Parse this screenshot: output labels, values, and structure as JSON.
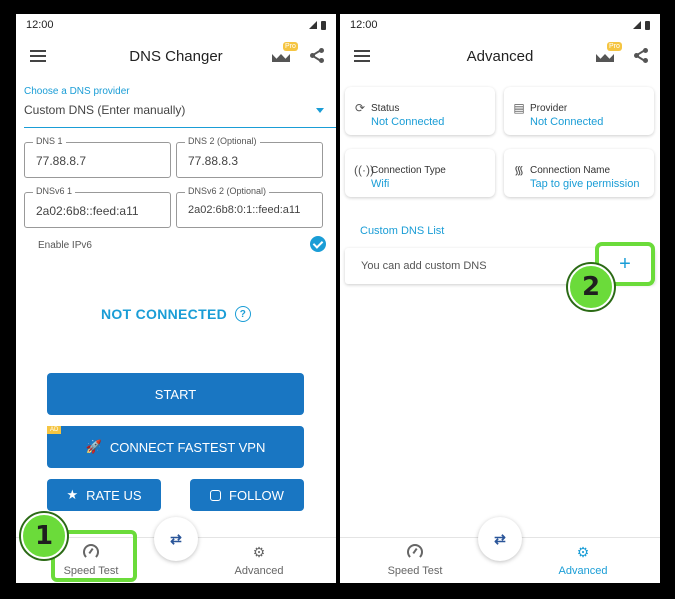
{
  "left": {
    "time": "12:00",
    "title": "DNS Changer",
    "pro_badge": "Pro",
    "provider_label": "Choose a DNS provider",
    "provider_value": "Custom DNS (Enter manually)",
    "fields": [
      {
        "label": "DNS 1",
        "value": "77.88.8.7"
      },
      {
        "label": "DNS 2 (Optional)",
        "value": "77.88.8.3"
      },
      {
        "label": "DNSv6 1",
        "value": "2a02:6b8::feed:a11"
      },
      {
        "label": "DNSv6 2 (Optional)",
        "value": "2a02:6b8:0:1::feed:a11"
      }
    ],
    "enable_ipv6": "Enable IPv6",
    "status": "NOT CONNECTED",
    "help": "?",
    "start": "START",
    "ad_badge": "AD",
    "vpn": "CONNECT FASTEST VPN",
    "rate": "RATE US",
    "follow": "FOLLOW",
    "nav": {
      "speed": "Speed Test",
      "advanced": "Advanced"
    }
  },
  "right": {
    "time": "12:00",
    "title": "Advanced",
    "pro_badge": "Pro",
    "cards": [
      {
        "title": "Status",
        "value": "Not Connected",
        "icon": "sync-icon"
      },
      {
        "title": "Provider",
        "value": "Not Connected",
        "icon": "server-icon"
      },
      {
        "title": "Connection Type",
        "value": "Wifi",
        "icon": "antenna-icon"
      },
      {
        "title": "Connection Name",
        "value": "Tap to give permission",
        "icon": "wifi-icon"
      }
    ],
    "section": "Custom DNS List",
    "empty_text": "You can add custom DNS",
    "add": "+",
    "nav": {
      "speed": "Speed Test",
      "advanced": "Advanced"
    }
  },
  "steps": [
    "1",
    "2"
  ],
  "colors": {
    "accent": "#1a9dd6",
    "button": "#1976c2",
    "highlight": "#6bdb3a"
  }
}
